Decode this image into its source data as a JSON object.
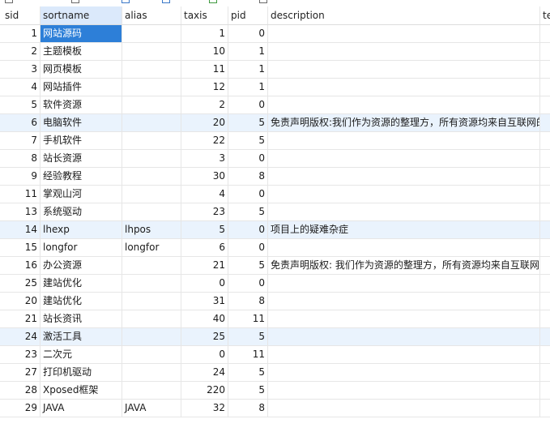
{
  "columns": {
    "sid": "sid",
    "sortname": "sortname",
    "alias": "alias",
    "taxis": "taxis",
    "pid": "pid",
    "description": "description",
    "te": "te"
  },
  "rows": [
    {
      "sid": "1",
      "sortname": "网站源码",
      "alias": "",
      "taxis": "1",
      "pid": "0",
      "description": ""
    },
    {
      "sid": "2",
      "sortname": "主题模板",
      "alias": "",
      "taxis": "10",
      "pid": "1",
      "description": ""
    },
    {
      "sid": "3",
      "sortname": "网页模板",
      "alias": "",
      "taxis": "11",
      "pid": "1",
      "description": ""
    },
    {
      "sid": "4",
      "sortname": "网站插件",
      "alias": "",
      "taxis": "12",
      "pid": "1",
      "description": ""
    },
    {
      "sid": "5",
      "sortname": "软件资源",
      "alias": "",
      "taxis": "2",
      "pid": "0",
      "description": ""
    },
    {
      "sid": "6",
      "sortname": "电脑软件",
      "alias": "",
      "taxis": "20",
      "pid": "5",
      "description": "免责声明版权:我们作为资源的整理方，所有资源均来自互联网的"
    },
    {
      "sid": "7",
      "sortname": "手机软件",
      "alias": "",
      "taxis": "22",
      "pid": "5",
      "description": ""
    },
    {
      "sid": "8",
      "sortname": "站长资源",
      "alias": "",
      "taxis": "3",
      "pid": "0",
      "description": ""
    },
    {
      "sid": "9",
      "sortname": "经验教程",
      "alias": "",
      "taxis": "30",
      "pid": "8",
      "description": ""
    },
    {
      "sid": "11",
      "sortname": "掌观山河",
      "alias": "",
      "taxis": "4",
      "pid": "0",
      "description": ""
    },
    {
      "sid": "13",
      "sortname": "系统驱动",
      "alias": "",
      "taxis": "23",
      "pid": "5",
      "description": ""
    },
    {
      "sid": "14",
      "sortname": "lhexp",
      "alias": "lhpos",
      "taxis": "5",
      "pid": "0",
      "description": "项目上的疑难杂症"
    },
    {
      "sid": "15",
      "sortname": "longfor",
      "alias": "longfor",
      "taxis": "6",
      "pid": "0",
      "description": ""
    },
    {
      "sid": "16",
      "sortname": "办公资源",
      "alias": "",
      "taxis": "21",
      "pid": "5",
      "description": "免责声明版权: 我们作为资源的整理方，所有资源均来自互联网"
    },
    {
      "sid": "25",
      "sortname": " 建站优化",
      "alias": "",
      "taxis": "0",
      "pid": "0",
      "description": ""
    },
    {
      "sid": "20",
      "sortname": "建站优化",
      "alias": "",
      "taxis": "31",
      "pid": "8",
      "description": ""
    },
    {
      "sid": "21",
      "sortname": "站长资讯",
      "alias": "",
      "taxis": "40",
      "pid": "11",
      "description": ""
    },
    {
      "sid": "24",
      "sortname": "激活工具",
      "alias": "",
      "taxis": "25",
      "pid": "5",
      "description": ""
    },
    {
      "sid": "23",
      "sortname": "二次元",
      "alias": "",
      "taxis": "0",
      "pid": "11",
      "description": ""
    },
    {
      "sid": "27",
      "sortname": "打印机驱动",
      "alias": "",
      "taxis": "24",
      "pid": "5",
      "description": ""
    },
    {
      "sid": "28",
      "sortname": "Xposed框架",
      "alias": "",
      "taxis": "220",
      "pid": "5",
      "description": ""
    },
    {
      "sid": "29",
      "sortname": "JAVA",
      "alias": "JAVA",
      "taxis": "32",
      "pid": "8",
      "description": ""
    }
  ],
  "selection": {
    "row": 0,
    "column": "sortname"
  },
  "colors": {
    "selection": "#2d7fd8",
    "header_highlight": "#dbe9fb",
    "row_alt": "#f7f9fc"
  }
}
